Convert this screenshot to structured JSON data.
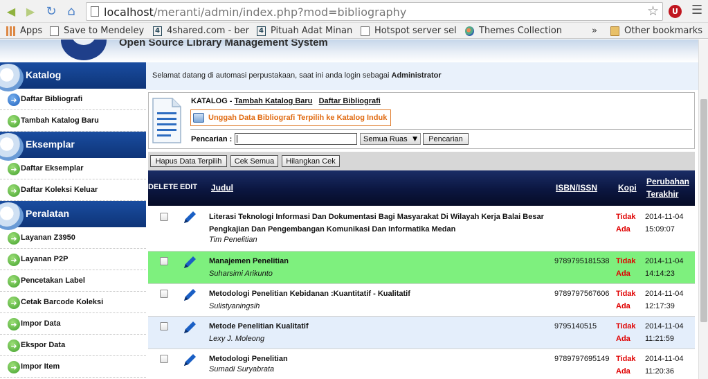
{
  "browser": {
    "url_host": "localhost",
    "url_path": "/meranti/admin/index.php?mod=bibliography",
    "ext_label": "U",
    "bookmarks": [
      {
        "label": "Apps",
        "icon": "apps-grid-icon"
      },
      {
        "label": "Save to Mendeley",
        "icon": "page-icon"
      },
      {
        "label": "4shared.com - ber",
        "icon": "4shared-icon"
      },
      {
        "label": "Pituah Adat Minan",
        "icon": "4shared-icon"
      },
      {
        "label": "Hotspot server sel",
        "icon": "page-icon"
      },
      {
        "label": "Themes Collection",
        "icon": "theme-icon"
      }
    ],
    "more": "»",
    "other_bookmarks": "Other bookmarks"
  },
  "header": {
    "title": "Open Source Library Management System"
  },
  "sidebar": {
    "sections": [
      {
        "title": "Katalog",
        "items": [
          "Daftar Bibliografi",
          "Tambah Katalog Baru"
        ]
      },
      {
        "title": "Eksemplar",
        "items": [
          "Daftar Eksemplar",
          "Daftar Koleksi Keluar"
        ]
      },
      {
        "title": "Peralatan",
        "items": [
          "Layanan Z3950",
          "Layanan P2P",
          "Pencetakan Label",
          "Cetak Barcode Koleksi",
          "Impor Data",
          "Ekspor Data",
          "Impor Item"
        ]
      }
    ]
  },
  "main": {
    "welcome_text": "Selamat datang di automasi perpustakaan, saat ini anda login sebagai ",
    "welcome_user": "Administrator",
    "catalog": {
      "section_label": "KATALOG",
      "separator": " - ",
      "link_add": "Tambah Katalog Baru",
      "link_list": "Daftar Bibliografi",
      "upload_label": "Unggah Data Bibliografi Terpilih ke Katalog Induk",
      "search_label": "Pencarian :",
      "search_value": "",
      "field_select": "Semua Ruas",
      "search_button": "Pencarian"
    },
    "actions": {
      "delete_selected": "Hapus Data Terpilih",
      "check_all": "Cek Semua",
      "uncheck_all": "Hilangkan Cek"
    },
    "table": {
      "headers": {
        "delete": "DELETE",
        "edit": "EDIT",
        "title": "Judul",
        "isbn": "ISBN/ISSN",
        "copies": "Kopi",
        "updated_line1": "Perubahan",
        "updated_line2": "Terakhir"
      },
      "rows": [
        {
          "title": "Literasi Teknologi Informasi Dan Dokumentasi Bagi Masyarakat Di Wilayah Kerja Balai Besar Pengkajian Dan Pengembangan Komunikasi Dan Informatika Medan",
          "author": "Tim Penelitian",
          "isbn": "",
          "copies_line1": "Tidak",
          "copies_line2": "Ada",
          "date": "2014-11-04",
          "time": "15:09:07",
          "bg": "white"
        },
        {
          "title": "Manajemen Penelitian",
          "author": "Suharsimi Arikunto",
          "isbn": "9789795181538",
          "copies_line1": "Tidak",
          "copies_line2": "Ada",
          "date": "2014-11-04",
          "time": "14:14:23",
          "bg": "green"
        },
        {
          "title": "Metodologi Penelitian Kebidanan :Kuantitatif - Kualitatif",
          "author": "Sulistyaningsih",
          "isbn": "9789797567606",
          "copies_line1": "Tidak",
          "copies_line2": "Ada",
          "date": "2014-11-04",
          "time": "12:17:39",
          "bg": "white"
        },
        {
          "title": "Metode Penelitian Kualitatif",
          "author": "Lexy J. Moleong",
          "isbn": "9795140515",
          "copies_line1": "Tidak",
          "copies_line2": "Ada",
          "date": "2014-11-04",
          "time": "11:21:59",
          "bg": "blue"
        },
        {
          "title": "Metodologi Penelitian",
          "author": "Sumadi Suryabrata",
          "isbn": "9789797695149",
          "copies_line1": "Tidak",
          "copies_line2": "Ada",
          "date": "2014-11-04",
          "time": "11:20:36",
          "bg": "white"
        }
      ]
    }
  },
  "colors": {
    "sidebar_header": "#0e3478",
    "list_header": "#0b1640",
    "highlight_row": "#7ef07e",
    "alt_row": "#e4eefb",
    "no_copies": "#e00000",
    "upload_border": "#e07b2a"
  }
}
